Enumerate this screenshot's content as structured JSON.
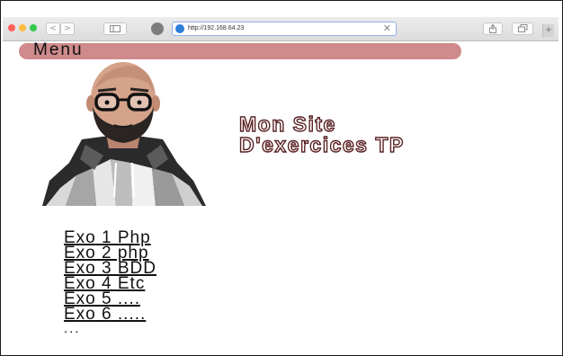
{
  "browser": {
    "url": "http://192.168.64.23",
    "clear_glyph": "✕",
    "back_glyph": "<",
    "forward_glyph": ">"
  },
  "menu": {
    "label": "Menu"
  },
  "site": {
    "title_line1": "Mon Site",
    "title_line2": "D'exercices TP"
  },
  "links": [
    {
      "label": "Exo 1 Php"
    },
    {
      "label": "Exo 2 php"
    },
    {
      "label": "Exo 3 BDD"
    },
    {
      "label": "Exo 4 Etc"
    },
    {
      "label": "Exo 5 ...."
    },
    {
      "label": "Exo 6 ....."
    }
  ],
  "more_text": "...",
  "colors": {
    "menu_bar": "#cf8a8c",
    "title_stroke": "#5a2224"
  },
  "icons": [
    "back-icon",
    "forward-icon",
    "sidebar-icon",
    "privacy-icon",
    "globe-icon",
    "close-icon",
    "share-icon",
    "tabs-icon",
    "new-tab-icon"
  ]
}
